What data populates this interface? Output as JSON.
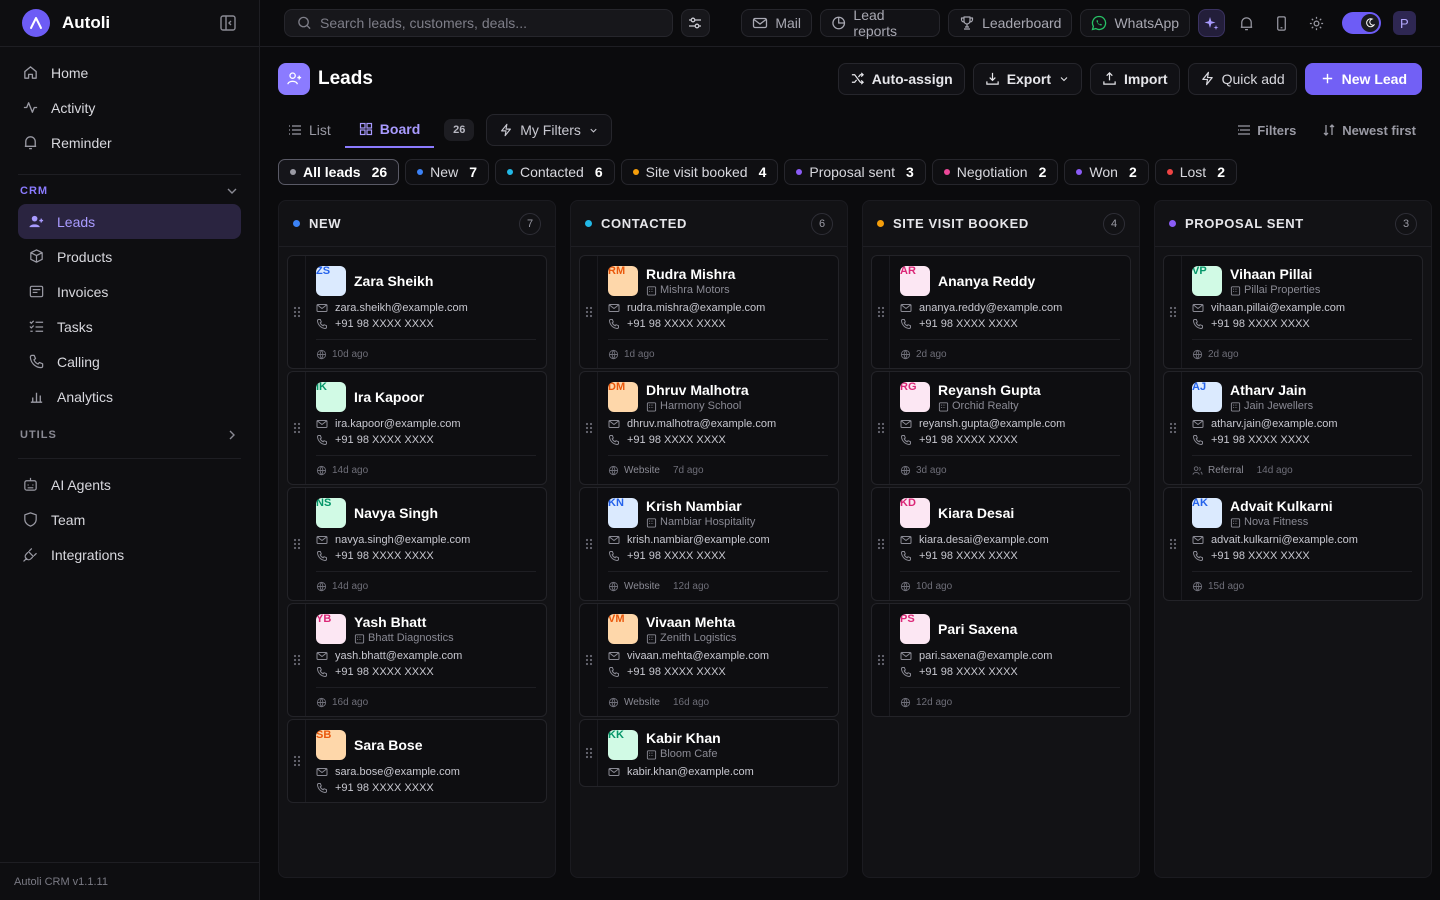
{
  "app": {
    "name": "Autoli",
    "version": "Autoli CRM v1.1.11"
  },
  "sidebar": {
    "top_items": [
      {
        "label": "Home",
        "icon": "home-icon"
      },
      {
        "label": "Activity",
        "icon": "activity-icon"
      },
      {
        "label": "Reminder",
        "icon": "bell-icon"
      }
    ],
    "crm_label": "CRM",
    "crm_items": [
      {
        "label": "Leads",
        "icon": "user-plus-icon",
        "active": true
      },
      {
        "label": "Products",
        "icon": "box-icon"
      },
      {
        "label": "Invoices",
        "icon": "invoice-icon"
      },
      {
        "label": "Tasks",
        "icon": "tasks-icon"
      },
      {
        "label": "Calling",
        "icon": "phone-icon"
      },
      {
        "label": "Analytics",
        "icon": "chart-icon"
      }
    ],
    "utils_label": "UTILS",
    "bottom_items": [
      {
        "label": "AI Agents",
        "icon": "robot-icon"
      },
      {
        "label": "Team",
        "icon": "shield-icon"
      },
      {
        "label": "Integrations",
        "icon": "plug-icon"
      }
    ]
  },
  "topbar": {
    "search_placeholder": "Search leads, customers, deals...",
    "links": {
      "mail": "Mail",
      "lead_reports": "Lead reports",
      "leaderboard": "Leaderboard",
      "whatsapp": "WhatsApp"
    },
    "user_initial": "P"
  },
  "header": {
    "title": "Leads",
    "actions": {
      "auto_assign": "Auto-assign",
      "export": "Export",
      "import": "Import",
      "quick_add": "Quick add",
      "new_lead": "New Lead"
    }
  },
  "views": {
    "list": "List",
    "board": "Board",
    "count": "26",
    "my_filters": "My Filters",
    "filters": "Filters",
    "sort": "Newest first"
  },
  "stages": [
    {
      "label": "All leads",
      "count": "26",
      "color": "#9a9aa4",
      "active": true
    },
    {
      "label": "New",
      "count": "7",
      "color": "#3b82f6"
    },
    {
      "label": "Contacted",
      "count": "6",
      "color": "#22b8e6"
    },
    {
      "label": "Site visit booked",
      "count": "4",
      "color": "#f59e0b"
    },
    {
      "label": "Proposal sent",
      "count": "3",
      "color": "#8b5cf6"
    },
    {
      "label": "Negotiation",
      "count": "2",
      "color": "#ec4899"
    },
    {
      "label": "Won",
      "count": "2",
      "color": "#8b5cf6"
    },
    {
      "label": "Lost",
      "count": "2",
      "color": "#ef4444"
    }
  ],
  "columns": [
    {
      "title": "NEW",
      "count": "7",
      "color": "#3b82f6",
      "cards": [
        {
          "initials": "ZS",
          "name": "Zara Sheikh",
          "company": "",
          "email": "zara.sheikh@example.com",
          "phone": "+91 98 XXXX XXXX",
          "source": "",
          "age": "10d ago",
          "bg": "#dbeafe",
          "fg": "#2563eb"
        },
        {
          "initials": "IK",
          "name": "Ira Kapoor",
          "company": "",
          "email": "ira.kapoor@example.com",
          "phone": "+91 98 XXXX XXXX",
          "source": "",
          "age": "14d ago",
          "bg": "#d1fae5",
          "fg": "#059669"
        },
        {
          "initials": "NS",
          "name": "Navya Singh",
          "company": "",
          "email": "navya.singh@example.com",
          "phone": "+91 98 XXXX XXXX",
          "source": "",
          "age": "14d ago",
          "bg": "#d1fae5",
          "fg": "#059669"
        },
        {
          "initials": "YB",
          "name": "Yash Bhatt",
          "company": "Bhatt Diagnostics",
          "email": "yash.bhatt@example.com",
          "phone": "+91 98 XXXX XXXX",
          "source": "",
          "age": "16d ago",
          "bg": "#fce7f3",
          "fg": "#db2777"
        },
        {
          "initials": "SB",
          "name": "Sara Bose",
          "company": "",
          "email": "sara.bose@example.com",
          "phone": "+91 98 XXXX XXXX",
          "source": "",
          "age": "",
          "bg": "#fed7aa",
          "fg": "#ea580c"
        }
      ]
    },
    {
      "title": "CONTACTED",
      "count": "6",
      "color": "#22b8e6",
      "cards": [
        {
          "initials": "RM",
          "name": "Rudra Mishra",
          "company": "Mishra Motors",
          "email": "rudra.mishra@example.com",
          "phone": "+91 98 XXXX XXXX",
          "source": "",
          "age": "1d ago",
          "bg": "#fed7aa",
          "fg": "#ea580c"
        },
        {
          "initials": "DM",
          "name": "Dhruv Malhotra",
          "company": "Harmony School",
          "email": "dhruv.malhotra@example.com",
          "phone": "+91 98 XXXX XXXX",
          "source": "Website",
          "age": "7d ago",
          "bg": "#fed7aa",
          "fg": "#ea580c"
        },
        {
          "initials": "KN",
          "name": "Krish Nambiar",
          "company": "Nambiar Hospitality",
          "email": "krish.nambiar@example.com",
          "phone": "+91 98 XXXX XXXX",
          "source": "Website",
          "age": "12d ago",
          "bg": "#dbeafe",
          "fg": "#2563eb"
        },
        {
          "initials": "VM",
          "name": "Vivaan Mehta",
          "company": "Zenith Logistics",
          "email": "vivaan.mehta@example.com",
          "phone": "+91 98 XXXX XXXX",
          "source": "Website",
          "age": "16d ago",
          "bg": "#fed7aa",
          "fg": "#ea580c"
        },
        {
          "initials": "KK",
          "name": "Kabir Khan",
          "company": "Bloom Cafe",
          "email": "kabir.khan@example.com",
          "phone": "",
          "source": "",
          "age": "",
          "bg": "#d1fae5",
          "fg": "#059669"
        }
      ]
    },
    {
      "title": "SITE VISIT BOOKED",
      "count": "4",
      "color": "#f59e0b",
      "cards": [
        {
          "initials": "AR",
          "name": "Ananya Reddy",
          "company": "",
          "email": "ananya.reddy@example.com",
          "phone": "+91 98 XXXX XXXX",
          "source": "",
          "age": "2d ago",
          "bg": "#fce7f3",
          "fg": "#db2777"
        },
        {
          "initials": "RG",
          "name": "Reyansh Gupta",
          "company": "Orchid Realty",
          "email": "reyansh.gupta@example.com",
          "phone": "+91 98 XXXX XXXX",
          "source": "",
          "age": "3d ago",
          "bg": "#fce7f3",
          "fg": "#db2777"
        },
        {
          "initials": "KD",
          "name": "Kiara Desai",
          "company": "",
          "email": "kiara.desai@example.com",
          "phone": "+91 98 XXXX XXXX",
          "source": "",
          "age": "10d ago",
          "bg": "#fce7f3",
          "fg": "#db2777"
        },
        {
          "initials": "PS",
          "name": "Pari Saxena",
          "company": "",
          "email": "pari.saxena@example.com",
          "phone": "+91 98 XXXX XXXX",
          "source": "",
          "age": "12d ago",
          "bg": "#fce7f3",
          "fg": "#db2777"
        }
      ]
    },
    {
      "title": "PROPOSAL SENT",
      "count": "3",
      "color": "#8b5cf6",
      "cards": [
        {
          "initials": "VP",
          "name": "Vihaan Pillai",
          "company": "Pillai Properties",
          "email": "vihaan.pillai@example.com",
          "phone": "+91 98 XXXX XXXX",
          "source": "",
          "age": "2d ago",
          "bg": "#d1fae5",
          "fg": "#059669"
        },
        {
          "initials": "AJ",
          "name": "Atharv Jain",
          "company": "Jain Jewellers",
          "email": "atharv.jain@example.com",
          "phone": "+91 98 XXXX XXXX",
          "source": "Referral",
          "age": "14d ago",
          "bg": "#dbeafe",
          "fg": "#2563eb"
        },
        {
          "initials": "AK",
          "name": "Advait Kulkarni",
          "company": "Nova Fitness",
          "email": "advait.kulkarni@example.com",
          "phone": "+91 98 XXXX XXXX",
          "source": "",
          "age": "15d ago",
          "bg": "#dbeafe",
          "fg": "#2563eb"
        }
      ]
    }
  ]
}
